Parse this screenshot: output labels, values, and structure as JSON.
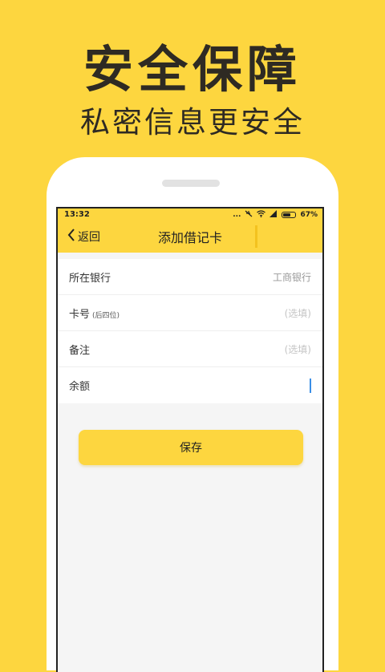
{
  "promo": {
    "title": "安全保障",
    "subtitle": "私密信息更安全"
  },
  "status_bar": {
    "time": "13:32",
    "dots": "...",
    "battery_text": "67%",
    "battery_level": 0.67
  },
  "nav": {
    "back_label": "返回",
    "title": "添加借记卡"
  },
  "form": {
    "bank": {
      "label": "所在银行",
      "value": "工商银行"
    },
    "card": {
      "label": "卡号",
      "hint": "(后四位)",
      "placeholder": "(选填)"
    },
    "note": {
      "label": "备注",
      "placeholder": "(选填)"
    },
    "balance": {
      "label": "余额"
    }
  },
  "save_label": "保存",
  "colors": {
    "accent": "#FDD63F",
    "text_dark": "#2E2A23",
    "cursor": "#3A8EE6"
  }
}
